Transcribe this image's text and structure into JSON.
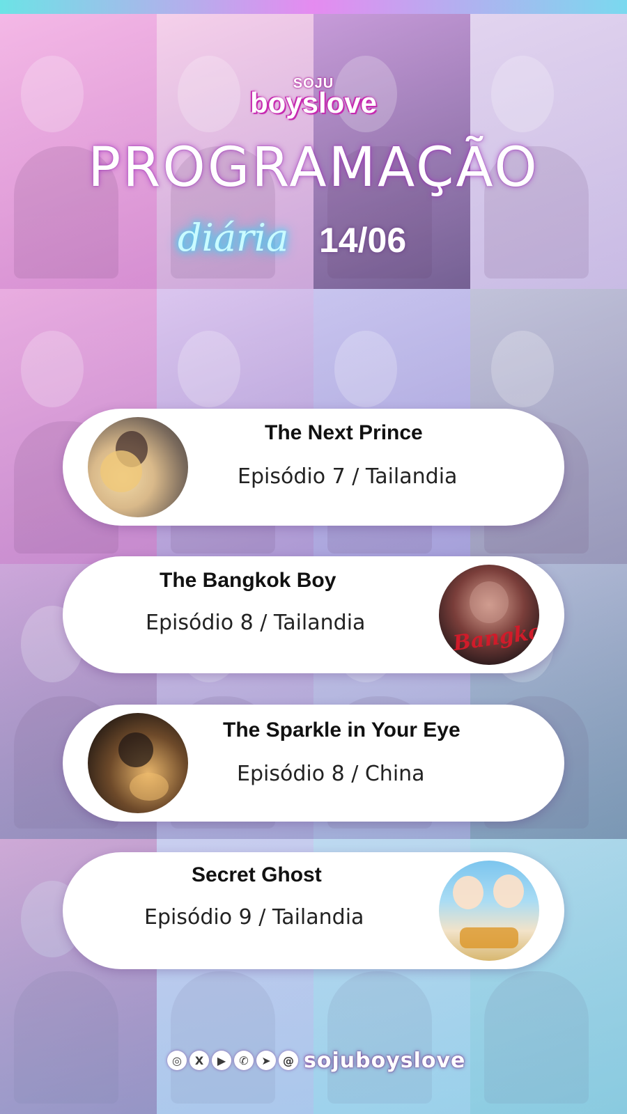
{
  "brand": {
    "small": "SOJU",
    "big": "boyslove"
  },
  "header": {
    "title": "PROGRAMAÇÃO",
    "cursive": "diária",
    "date": "14/06"
  },
  "schedule": [
    {
      "title": "The Next Prince",
      "subtitle": "Episódio 7 / Tailandia",
      "poster_icon": "poster-next-prince"
    },
    {
      "title": "The Bangkok Boy",
      "subtitle": "Episódio 8 / Tailandia",
      "poster_icon": "poster-bangkok-boy",
      "poster_text": "Bangkok"
    },
    {
      "title": "The Sparkle in Your Eye",
      "subtitle": "Episódio 8 / China",
      "poster_icon": "poster-sparkle"
    },
    {
      "title": "Secret Ghost",
      "subtitle": "Episódio 9 / Tailandia",
      "poster_icon": "poster-secret-ghost"
    }
  ],
  "footer": {
    "icons": [
      {
        "name": "instagram-icon",
        "glyph": "◎"
      },
      {
        "name": "x-icon",
        "glyph": "X"
      },
      {
        "name": "youtube-icon",
        "glyph": "▶"
      },
      {
        "name": "whatsapp-icon",
        "glyph": "✆"
      },
      {
        "name": "telegram-icon",
        "glyph": "➤"
      },
      {
        "name": "threads-icon",
        "glyph": "@"
      }
    ],
    "handle": "sojuboyslove"
  },
  "colors": {
    "card": "#ffffff",
    "accent_magenta": "#c62ab0",
    "neon_cyan": "#2ee0ff",
    "bangkok_red": "#d01b2a"
  }
}
